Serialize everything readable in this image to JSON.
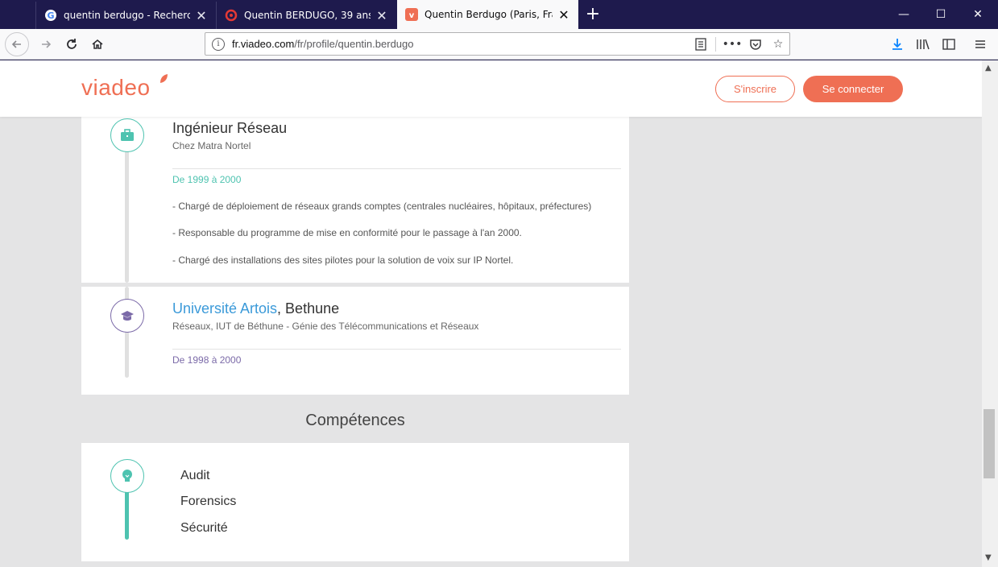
{
  "browser": {
    "tabs": [
      {
        "label": "quentin berdugo - Recherche G",
        "icon": "google-icon",
        "active": false
      },
      {
        "label": "Quentin BERDUGO, 39 ans (PAR",
        "icon": "swirl-icon",
        "active": false
      },
      {
        "label": "Quentin Berdugo (Paris, France",
        "icon": "viadeo-icon",
        "active": true
      }
    ],
    "url_domain": "fr.viadeo.com",
    "url_path": "/fr/profile/quentin.berdugo"
  },
  "header": {
    "logo": "viadeo",
    "signup_label": "S'inscrire",
    "login_label": "Se connecter"
  },
  "experience": {
    "title": "Ingénieur Réseau",
    "company": "Chez Matra Nortel",
    "dates": "De 1999 à 2000",
    "descriptions": [
      "- Chargé de déploiement de réseaux grands comptes (centrales nucléaires, hôpitaux, préfectures)",
      "- Responsable du programme de mise en conformité pour le passage à l'an 2000.",
      "- Chargé des installations des sites pilotes pour la solution de voix sur IP Nortel."
    ]
  },
  "education": {
    "school": "Université Artois",
    "city": ", Bethune",
    "degree": "Réseaux, IUT de Béthune - Génie des Télécommunications et Réseaux",
    "dates": "De 1998 à 2000"
  },
  "skills": {
    "title": "Compétences",
    "items": [
      "Audit",
      "Forensics",
      "Sécurité"
    ]
  },
  "colors": {
    "brand": "#ef6f54",
    "teal": "#4ec3b0",
    "purple": "#7b6aa8",
    "link": "#3b9ad9"
  }
}
